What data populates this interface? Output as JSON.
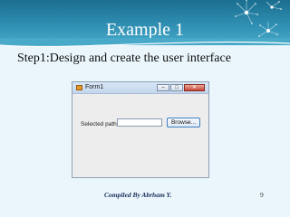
{
  "slide": {
    "title": "Example 1",
    "step": "Step1:Design and create the user interface",
    "footer": "Compiled By Abrham Y.",
    "page_number": "9"
  },
  "form_window": {
    "title": "Form1",
    "app_icon": "form-app-icon",
    "controls": {
      "minimize": "–",
      "maximize": "□",
      "close": "✕"
    },
    "label": "Selected path",
    "path_value": "",
    "browse_label": "Browse..."
  },
  "colors": {
    "header": "#2f8fb2",
    "background": "#eaf6fc",
    "form_body": "#ededed",
    "button_border": "#3f7fc0"
  }
}
